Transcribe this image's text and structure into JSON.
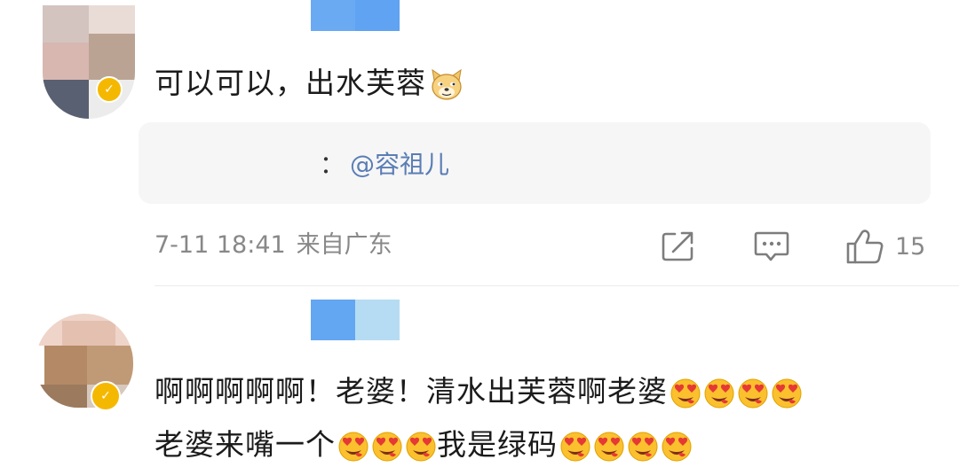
{
  "comments": [
    {
      "text": "可以可以，出水芙蓉",
      "reply": {
        "colon": "：",
        "mention": "@容祖儿"
      },
      "date": "7-11 18:41",
      "location": "来自广东",
      "like_count": "15",
      "emoji_after_text": "doge-icon"
    },
    {
      "line1": "啊啊啊啊啊！老婆！清水出芙蓉啊老婆",
      "line1_emoji_count": 4,
      "line2_part1": "老婆来嘴一个",
      "line2_part1_emoji_count": 3,
      "line2_part2": "我是绿码",
      "line2_part2_emoji_count": 4,
      "emoji_type": "heart-eyes-icon"
    }
  ],
  "colors": {
    "link": "#5a7db5",
    "meta": "#888888",
    "verified_badge": "#f5b800",
    "name_mosaic_blue": "#5fa3f2",
    "name_mosaic_light": "#b6dcf3"
  }
}
